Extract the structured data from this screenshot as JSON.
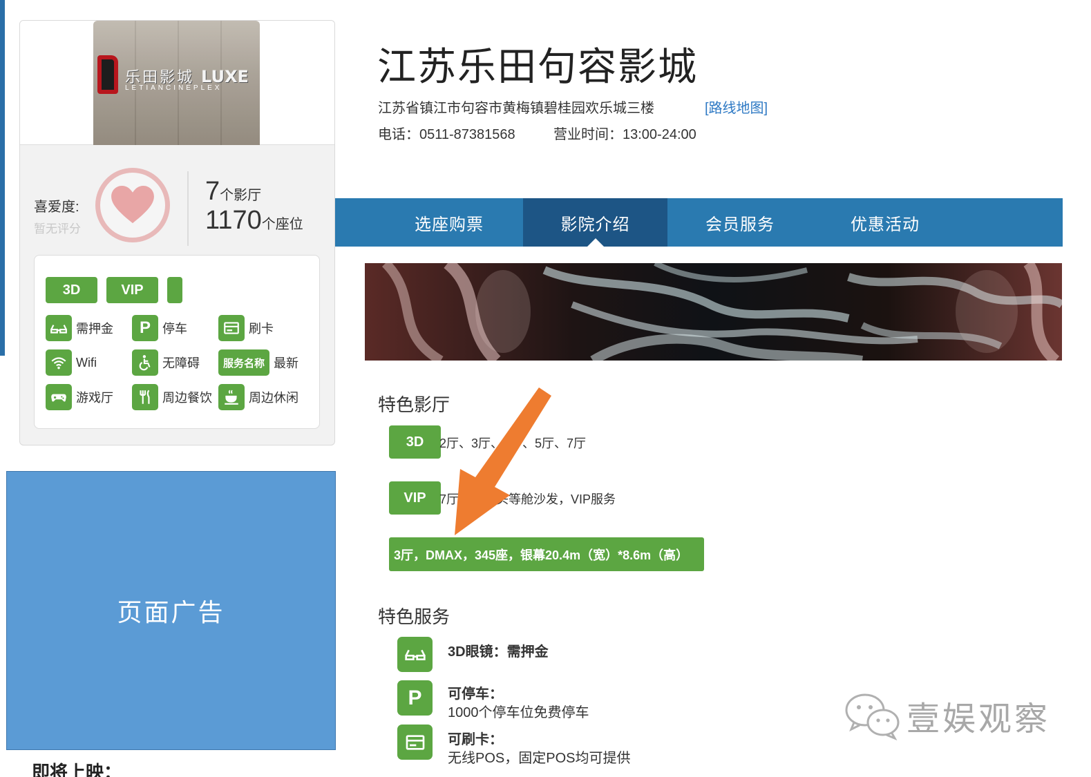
{
  "cinema": {
    "name": "江苏乐田句容影城",
    "address": "江苏省镇江市句容市黄梅镇碧桂园欢乐城三楼",
    "map_link": "[路线地图]",
    "phone": "电话：0511-87381568",
    "hours": "营业时间：13:00-24:00"
  },
  "photo": {
    "logo_text": "乐田影城",
    "logo_brand": "LUXE",
    "logo_sub": "LETIANCINEPLEX"
  },
  "rating": {
    "label": "喜爱度:",
    "value": "暂无评分"
  },
  "stats": {
    "halls_num": "7",
    "halls_unit": "个影厅",
    "seats_num": "1170",
    "seats_unit": "个座位"
  },
  "feature_tags": [
    "3D",
    "VIP"
  ],
  "features": [
    {
      "icon": "glasses-icon",
      "label": "需押金"
    },
    {
      "icon": "parking-icon",
      "label": "停车"
    },
    {
      "icon": "card-icon",
      "label": "刷卡"
    },
    {
      "icon": "wifi-icon",
      "label": "Wifi"
    },
    {
      "icon": "accessibility-icon",
      "label": "无障碍"
    },
    {
      "icon": "service-name-tag",
      "label": "最新",
      "tag": "服务名称"
    },
    {
      "icon": "gamepad-icon",
      "label": "游戏厅"
    },
    {
      "icon": "dining-icon",
      "label": "周边餐饮"
    },
    {
      "icon": "cup-icon",
      "label": "周边休闲"
    }
  ],
  "ad": {
    "label": "页面广告"
  },
  "coming_soon": "即将上映：",
  "nav": {
    "tabs": [
      {
        "label": "选座购票",
        "active": false
      },
      {
        "label": "影院介绍",
        "active": true
      },
      {
        "label": "会员服务",
        "active": false
      },
      {
        "label": "优惠活动",
        "active": false
      }
    ]
  },
  "featured_halls": {
    "title": "特色影厅",
    "items": [
      {
        "tag": "3D",
        "desc": "2厅、3厅、4厅、5厅、7厅"
      },
      {
        "tag": "VIP",
        "desc": "7厅，座，头等舱沙发，VIP服务"
      }
    ],
    "dmax": "3厅，DMAX，345座，银幕20.4m（宽）*8.6m（高）"
  },
  "featured_services": {
    "title": "特色服务",
    "items": [
      {
        "icon": "glasses-icon",
        "title": "3D眼镜：需押金",
        "desc": ""
      },
      {
        "icon": "parking-icon",
        "title": "可停车：",
        "desc": "1000个停车位免费停车"
      },
      {
        "icon": "card-icon",
        "title": "可刷卡：",
        "desc": "无线POS，固定POS均可提供"
      }
    ]
  },
  "watermark": "壹娱观察",
  "colors": {
    "nav": "#2a7ab0",
    "nav_active": "#1d5585",
    "green": "#5ca642",
    "ad": "#5b9bd5",
    "link": "#2e79c4",
    "arrow": "#ee7c30"
  }
}
